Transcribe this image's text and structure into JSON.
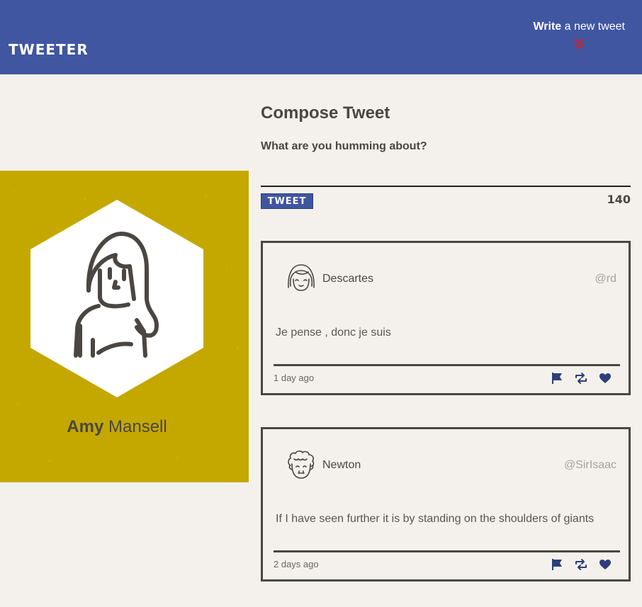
{
  "header": {
    "brand": "TWEETER",
    "write_bold": "Write",
    "write_rest": " a new tweet",
    "chevron_icon": "double-chevron-down-icon",
    "colors": {
      "nav_bg": "#4056a1",
      "chevron": "#d0202a"
    }
  },
  "profile": {
    "first_name": "Amy",
    "last_name": "Mansell",
    "avatar_icon": "woman-avatar-icon",
    "bg_color": "#c4a800"
  },
  "compose": {
    "title": "Compose Tweet",
    "label": "What are you humming about?",
    "input_value": "",
    "button_label": "TWEET",
    "counter": "140"
  },
  "tweets": [
    {
      "name": "Descartes",
      "handle": "@rd",
      "body": "Je pense , donc je suis",
      "time": "1 day ago",
      "avatar_icon": "bob-hair-avatar-icon",
      "actions": [
        "flag-icon",
        "retweet-icon",
        "heart-icon"
      ]
    },
    {
      "name": "Newton",
      "handle": "@SirIsaac",
      "body": "If I have seen further it is by standing on the shoulders of giants",
      "time": "2 days ago",
      "avatar_icon": "curly-hair-avatar-icon",
      "actions": [
        "flag-icon",
        "retweet-icon",
        "heart-icon"
      ]
    }
  ]
}
